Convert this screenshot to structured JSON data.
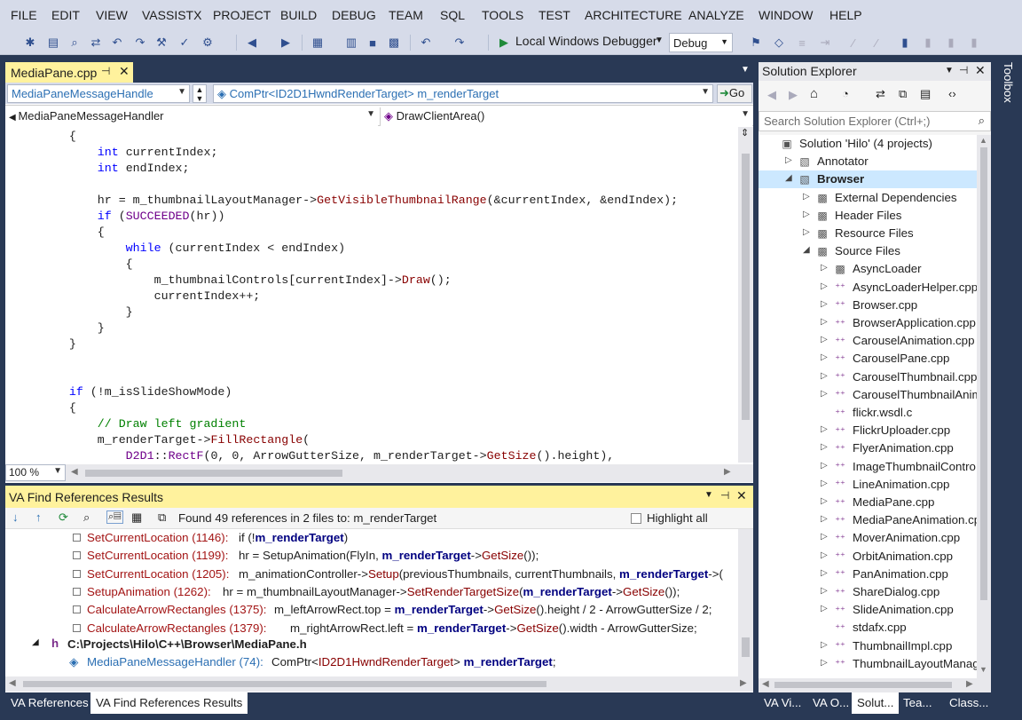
{
  "menu": [
    "FILE",
    "EDIT",
    "VIEW",
    "VASSISTX",
    "PROJECT",
    "BUILD",
    "DEBUG",
    "TEAM",
    "SQL",
    "TOOLS",
    "TEST",
    "ARCHITECTURE",
    "ANALYZE",
    "WINDOW",
    "HELP"
  ],
  "toolbar": {
    "run_label": "Local Windows Debugger",
    "config": "Debug"
  },
  "editor": {
    "tab": "MediaPane.cpp",
    "nav_class": "MediaPaneMessageHandle",
    "nav_member": "ComPtr<ID2D1HwndRenderTarget> m_renderTarget",
    "go_label": "Go",
    "nav_scope": "MediaPaneMessageHandler",
    "nav_function": "DrawClientArea()",
    "zoom": "100 %",
    "code": [
      [
        [
          "",
          ""
        ],
        [
          "p",
          "        {"
        ]
      ],
      [
        [
          "p",
          "            "
        ],
        [
          "kw",
          "int"
        ],
        [
          "p",
          " currentIndex;"
        ]
      ],
      [
        [
          "p",
          "            "
        ],
        [
          "kw",
          "int"
        ],
        [
          "p",
          " endIndex;"
        ]
      ],
      [
        [
          "p",
          ""
        ]
      ],
      [
        [
          "p",
          "            hr = m_thumbnailLayoutManager->"
        ],
        [
          "fn",
          "GetVisibleThumbnailRange"
        ],
        [
          "p",
          "(&currentIndex, &endIndex);"
        ]
      ],
      [
        [
          "p",
          "            "
        ],
        [
          "kw",
          "if"
        ],
        [
          "p",
          " ("
        ],
        [
          "mac",
          "SUCCEEDED"
        ],
        [
          "p",
          "(hr))"
        ]
      ],
      [
        [
          "p",
          "            {"
        ]
      ],
      [
        [
          "p",
          "                "
        ],
        [
          "kw",
          "while"
        ],
        [
          "p",
          " (currentIndex < endIndex)"
        ]
      ],
      [
        [
          "p",
          "                {"
        ]
      ],
      [
        [
          "p",
          "                    m_thumbnailControls[currentIndex]->"
        ],
        [
          "fn",
          "Draw"
        ],
        [
          "p",
          "();"
        ]
      ],
      [
        [
          "p",
          "                    currentIndex++;"
        ]
      ],
      [
        [
          "p",
          "                }"
        ]
      ],
      [
        [
          "p",
          "            }"
        ]
      ],
      [
        [
          "p",
          "        }"
        ]
      ],
      [
        [
          "p",
          ""
        ]
      ],
      [
        [
          "p",
          ""
        ]
      ],
      [
        [
          "p",
          "        "
        ],
        [
          "kw",
          "if"
        ],
        [
          "p",
          " (!m_isSlideShowMode)"
        ]
      ],
      [
        [
          "p",
          "        {"
        ]
      ],
      [
        [
          "cm",
          "            // Draw left gradient"
        ]
      ],
      [
        [
          "p",
          "            m_renderTarget->"
        ],
        [
          "fn",
          "FillRectangle"
        ],
        [
          "p",
          "("
        ]
      ],
      [
        [
          "p",
          "                "
        ],
        [
          "mac",
          "D2D1"
        ],
        [
          "p",
          "::"
        ],
        [
          "mac",
          "RectF"
        ],
        [
          "p",
          "(0, 0, ArrowGutterSize, m_renderTarget->"
        ],
        [
          "fn",
          "GetSize"
        ],
        [
          "p",
          "().height),"
        ]
      ]
    ]
  },
  "findrefs": {
    "title": "VA Find References Results",
    "summary": "Found 49 references in 2 files to: m_renderTarget",
    "highlight_all": "Highlight all",
    "rows": [
      {
        "name": "SetCurrentLocation (1146):",
        "code": [
          [
            "p",
            "if (!"
          ],
          [
            "b",
            "m_renderTarget"
          ],
          [
            "p",
            ")"
          ]
        ]
      },
      {
        "name": "SetCurrentLocation (1199):",
        "code": [
          [
            "p",
            "hr = SetupAnimation(FlyIn, "
          ],
          [
            "b",
            "m_renderTarget"
          ],
          [
            "p",
            "->"
          ],
          [
            "f",
            "GetSize"
          ],
          [
            "p",
            "());"
          ]
        ]
      },
      {
        "name": "SetCurrentLocation (1205):",
        "code": [
          [
            "p",
            "m_animationController->"
          ],
          [
            "f",
            "Setup"
          ],
          [
            "p",
            "(previousThumbnails, currentThumbnails, "
          ],
          [
            "b",
            "m_renderTarget"
          ],
          [
            "p",
            "->("
          ]
        ]
      },
      {
        "name": "SetupAnimation (1262):",
        "code": [
          [
            "p",
            "hr = m_thumbnailLayoutManager->"
          ],
          [
            "f",
            "SetRenderTargetSize"
          ],
          [
            "p",
            "("
          ],
          [
            "b",
            "m_renderTarget"
          ],
          [
            "p",
            "->"
          ],
          [
            "f",
            "GetSize"
          ],
          [
            "p",
            "());"
          ]
        ]
      },
      {
        "name": "CalculateArrowRectangles (1375):",
        "code": [
          [
            "p",
            "m_leftArrowRect.top = "
          ],
          [
            "b",
            "m_renderTarget"
          ],
          [
            "p",
            "->"
          ],
          [
            "f",
            "GetSize"
          ],
          [
            "p",
            "().height / 2 - ArrowGutterSize / 2;"
          ]
        ]
      },
      {
        "name": "CalculateArrowRectangles (1379):",
        "code": [
          [
            "p",
            "m_rightArrowRect.left = "
          ],
          [
            "b",
            "m_renderTarget"
          ],
          [
            "p",
            "->"
          ],
          [
            "f",
            "GetSize"
          ],
          [
            "p",
            "().width - ArrowGutterSize;"
          ]
        ]
      }
    ],
    "file_header": "C:\\Projects\\Hilo\\C++\\Browser\\MediaPane.h",
    "last_row": {
      "name": "MediaPaneMessageHandler (74):",
      "code": [
        [
          "p",
          "ComPtr<"
        ],
        [
          "f",
          "ID2D1HwndRenderTarget"
        ],
        [
          "p",
          "> "
        ],
        [
          "b",
          "m_renderTarget"
        ],
        [
          "p",
          ";"
        ]
      ]
    }
  },
  "bottom_tabs": [
    "VA References",
    "VA Find References Results"
  ],
  "right_bottom_tabs": [
    "VA Vi...",
    "VA O...",
    "Solut...",
    "Tea...",
    "Class..."
  ],
  "solution_explorer": {
    "title": "Solution Explorer",
    "search_placeholder": "Search Solution Explorer (Ctrl+;)",
    "tree": [
      {
        "label": "Solution 'Hilo' (4 projects)",
        "level": 0,
        "exp": "",
        "icon": "sln"
      },
      {
        "label": "Annotator",
        "level": 1,
        "exp": "▷",
        "icon": "proj"
      },
      {
        "label": "Browser",
        "level": 1,
        "exp": "◢",
        "icon": "proj",
        "selected": true
      },
      {
        "label": "External Dependencies",
        "level": 2,
        "exp": "▷",
        "icon": "folder"
      },
      {
        "label": "Header Files",
        "level": 2,
        "exp": "▷",
        "icon": "folder"
      },
      {
        "label": "Resource Files",
        "level": 2,
        "exp": "▷",
        "icon": "folder"
      },
      {
        "label": "Source Files",
        "level": 2,
        "exp": "◢",
        "icon": "folder"
      },
      {
        "label": "AsyncLoader",
        "level": 3,
        "exp": "▷",
        "icon": "folder"
      },
      {
        "label": "AsyncLoaderHelper.cpp",
        "level": 3,
        "exp": "▷",
        "icon": "cpp"
      },
      {
        "label": "Browser.cpp",
        "level": 3,
        "exp": "▷",
        "icon": "cpp"
      },
      {
        "label": "BrowserApplication.cpp",
        "level": 3,
        "exp": "▷",
        "icon": "cpp"
      },
      {
        "label": "CarouselAnimation.cpp",
        "level": 3,
        "exp": "▷",
        "icon": "cpp"
      },
      {
        "label": "CarouselPane.cpp",
        "level": 3,
        "exp": "▷",
        "icon": "cpp"
      },
      {
        "label": "CarouselThumbnail.cpp",
        "level": 3,
        "exp": "▷",
        "icon": "cpp"
      },
      {
        "label": "CarouselThumbnailAnim",
        "level": 3,
        "exp": "▷",
        "icon": "cpp"
      },
      {
        "label": "flickr.wsdl.c",
        "level": 3,
        "exp": "",
        "icon": "cpp"
      },
      {
        "label": "FlickrUploader.cpp",
        "level": 3,
        "exp": "▷",
        "icon": "cpp"
      },
      {
        "label": "FlyerAnimation.cpp",
        "level": 3,
        "exp": "▷",
        "icon": "cpp"
      },
      {
        "label": "ImageThumbnailContro",
        "level": 3,
        "exp": "▷",
        "icon": "cpp"
      },
      {
        "label": "LineAnimation.cpp",
        "level": 3,
        "exp": "▷",
        "icon": "cpp"
      },
      {
        "label": "MediaPane.cpp",
        "level": 3,
        "exp": "▷",
        "icon": "cpp"
      },
      {
        "label": "MediaPaneAnimation.cp",
        "level": 3,
        "exp": "▷",
        "icon": "cpp"
      },
      {
        "label": "MoverAnimation.cpp",
        "level": 3,
        "exp": "▷",
        "icon": "cpp"
      },
      {
        "label": "OrbitAnimation.cpp",
        "level": 3,
        "exp": "▷",
        "icon": "cpp"
      },
      {
        "label": "PanAnimation.cpp",
        "level": 3,
        "exp": "▷",
        "icon": "cpp"
      },
      {
        "label": "ShareDialog.cpp",
        "level": 3,
        "exp": "▷",
        "icon": "cpp"
      },
      {
        "label": "SlideAnimation.cpp",
        "level": 3,
        "exp": "▷",
        "icon": "cpp"
      },
      {
        "label": "stdafx.cpp",
        "level": 3,
        "exp": "",
        "icon": "cpp"
      },
      {
        "label": "ThumbnailImpl.cpp",
        "level": 3,
        "exp": "▷",
        "icon": "cpp"
      },
      {
        "label": "ThumbnailLayoutManag",
        "level": 3,
        "exp": "▷",
        "icon": "cpp"
      }
    ]
  },
  "toolbox_label": "Toolbox",
  "colors": {
    "chrome": "#293955",
    "menu_bg": "#d6dbe9",
    "active_tab": "#fff29d"
  }
}
